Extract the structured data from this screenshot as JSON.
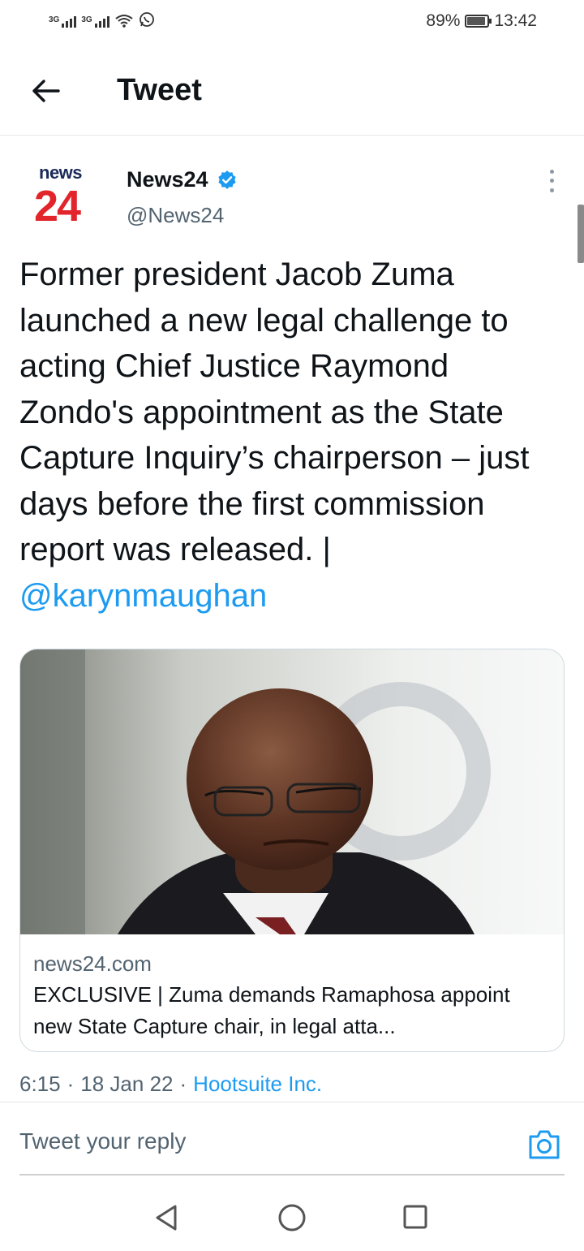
{
  "status_bar": {
    "signal1": "3G",
    "signal2": "3G",
    "battery_percent": "89%",
    "battery_level": 0.89,
    "time": "13:42",
    "icons": [
      "signal-icon",
      "wifi-icon",
      "whatsapp-icon",
      "battery-icon"
    ]
  },
  "header": {
    "title": "Tweet",
    "back_icon": "arrow-left-icon"
  },
  "tweet": {
    "author": {
      "logo_top": "news",
      "logo_bottom": "24",
      "name": "News24",
      "handle": "@News24",
      "verified": true
    },
    "text": "Former president Jacob Zuma launched a new legal challenge to acting Chief Justice Raymond Zondo's appointment as the State Capture Inquiry’s chairperson – just days before the first commission report was released. | ",
    "mention": "@karynmaughan",
    "card": {
      "domain": "news24.com",
      "title": "EXCLUSIVE | Zuma demands Ramaphosa appoint new State Capture chair, in legal atta..."
    },
    "time": "6:15",
    "sep1": "·",
    "date": "18 Jan 22",
    "sep2": "·",
    "source": "Hootsuite Inc."
  },
  "reply": {
    "placeholder": "Tweet your reply"
  },
  "colors": {
    "accent": "#1d9bf0",
    "brand_red": "#e1252b",
    "brand_navy": "#1a2a5a",
    "text_secondary": "#536471"
  }
}
